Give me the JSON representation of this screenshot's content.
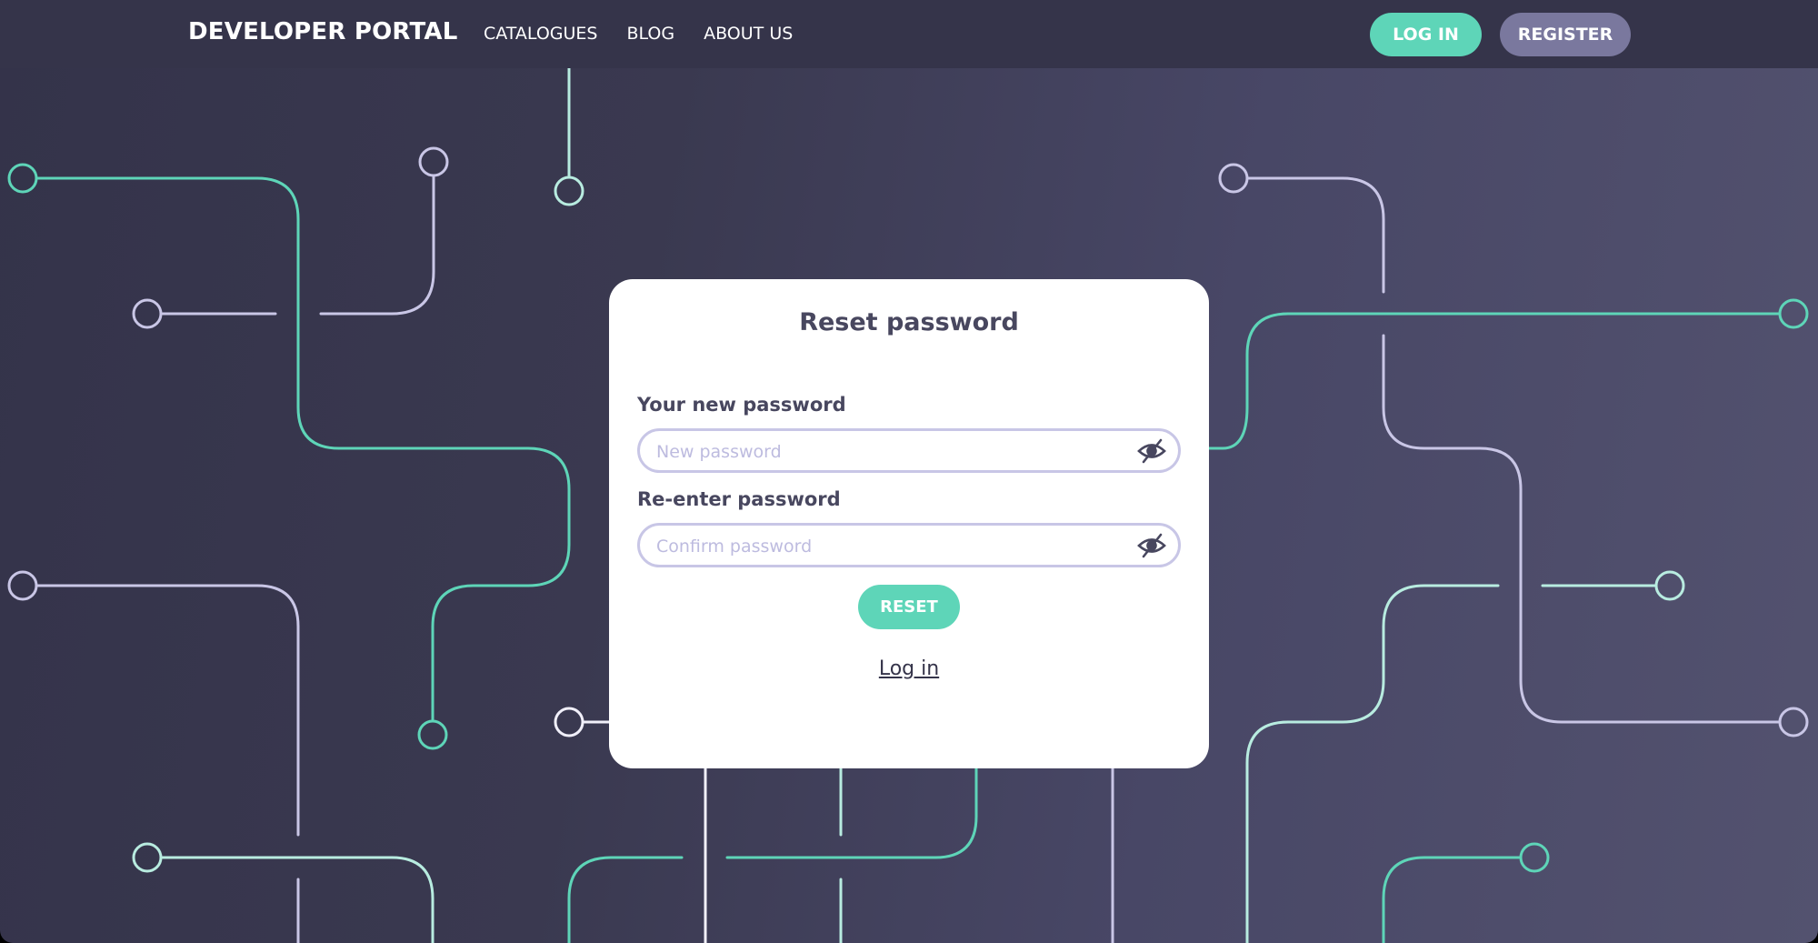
{
  "header": {
    "brand": "DEVELOPER PORTAL",
    "nav": [
      {
        "label": "CATALOGUES"
      },
      {
        "label": "BLOG"
      },
      {
        "label": "ABOUT US"
      }
    ],
    "login_label": "LOG IN",
    "register_label": "REGISTER"
  },
  "card": {
    "title": "Reset password",
    "new_password": {
      "label": "Your new password",
      "placeholder": "New password",
      "value": "",
      "icon": "eye-slash-icon"
    },
    "confirm_password": {
      "label": "Re-enter password",
      "placeholder": "Confirm password",
      "value": "",
      "icon": "eye-slash-icon"
    },
    "reset_label": "RESET",
    "login_link": "Log in"
  },
  "theme": {
    "accent": "#5ed5b8",
    "secondary": "#7a789e",
    "header_bg": "#35344a",
    "text_dark": "#48475f",
    "input_border": "#c8c6e6",
    "line_lavender": "#c9c6e6",
    "line_mint": "#b8ece0"
  }
}
